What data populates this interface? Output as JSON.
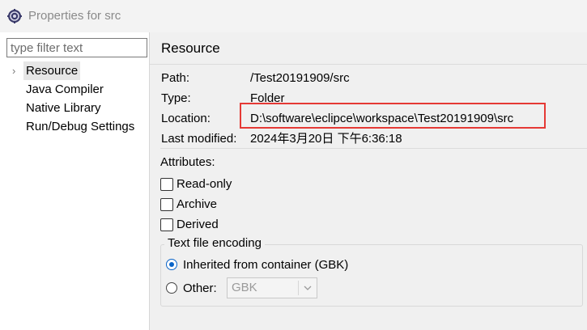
{
  "window": {
    "title": "Properties for src"
  },
  "sidebar": {
    "filter_placeholder": "type filter text",
    "items": [
      {
        "label": "Resource",
        "selected": true,
        "expandable": true
      },
      {
        "label": "Java Compiler"
      },
      {
        "label": "Native Library"
      },
      {
        "label": "Run/Debug Settings"
      }
    ]
  },
  "page": {
    "title": "Resource",
    "properties": {
      "path_label": "Path:",
      "path_value": "/Test20191909/src",
      "type_label": "Type:",
      "type_value": "Folder",
      "location_label": "Location:",
      "location_value": "D:\\software\\eclipce\\workspace\\Test20191909\\src",
      "modified_label": "Last modified:",
      "modified_value": "2024年3月20日 下午6:36:18"
    },
    "attributes": {
      "label": "Attributes:",
      "read_only": "Read-only",
      "archive": "Archive",
      "derived": "Derived"
    },
    "encoding": {
      "group_title": "Text file encoding",
      "inherited_label": "Inherited from container (GBK)",
      "other_label": "Other:",
      "other_value": "GBK"
    }
  },
  "colors": {
    "highlight_box": "#e53935",
    "radio_accent": "#0a64c8"
  }
}
